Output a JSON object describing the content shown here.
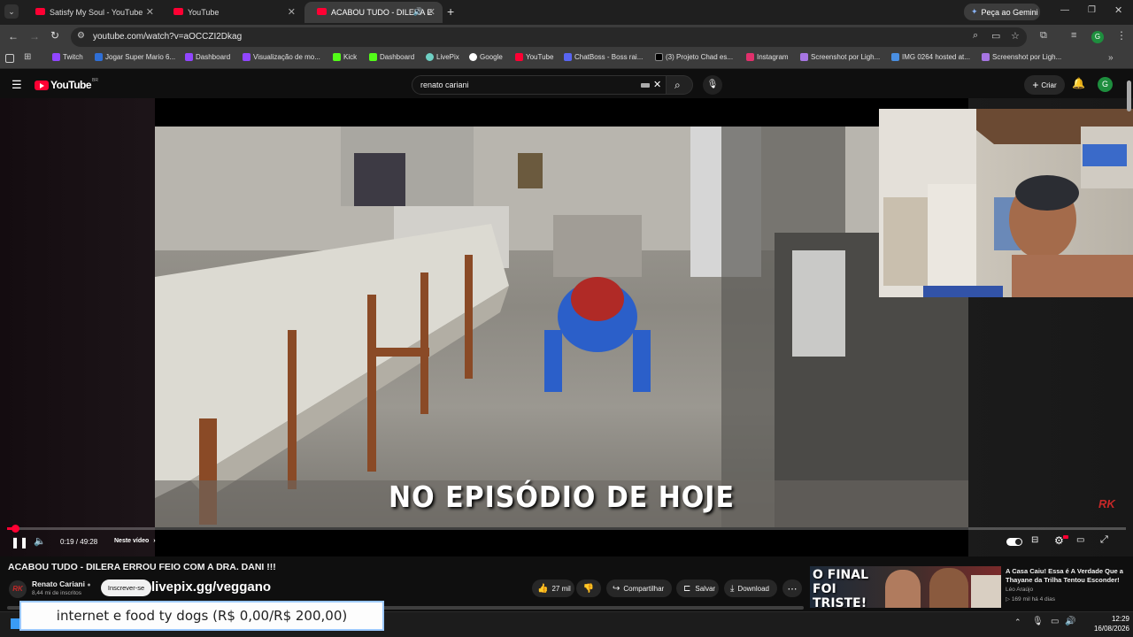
{
  "browser": {
    "tabs": [
      {
        "title": "Satisfy My Soul - YouTube"
      },
      {
        "title": "YouTube"
      },
      {
        "title": "ACABOU TUDO - DILERA E"
      }
    ],
    "gemini_label": "Peça ao Gemini",
    "url": "youtube.com/watch?v=aOCCZI2Dkag",
    "profile_initial": "G",
    "bookmarks": [
      "Twitch",
      "Jogar Super Mario 6...",
      "Dashboard",
      "Visualização de mo...",
      "Kick",
      "Dashboard",
      "LivePix",
      "Google",
      "YouTube",
      "ChatBoss - Boss rai...",
      "(3) Projeto Chad es...",
      "Instagram",
      "Screenshot por Ligh...",
      "IMG 0264 hosted at...",
      "Screenshot por Ligh..."
    ]
  },
  "youtube": {
    "logo_text": "YouTube",
    "logo_region": "BR",
    "search_value": "renato cariani",
    "create_label": "Criar",
    "avatar_initial": "G"
  },
  "player": {
    "subtitle": "NO EPISÓDIO DE HOJE",
    "time": "0:19 / 49:28",
    "chapter_label": "Neste vídeo",
    "progress": 0.0064
  },
  "video_info": {
    "title": "ACABOU TUDO - DILERA ERROU FEIO COM A DRA. DANI !!!",
    "channel_name": "Renato Cariani",
    "subscribers": "8,44 mi de inscritos",
    "subscribe_label": "Inscrever-se",
    "overlay_text": "livepix.gg/veggano",
    "likes": "27 mil",
    "share_label": "Compartilhar",
    "save_label": "Salvar",
    "download_label": "Download"
  },
  "recommended": {
    "thumb_text": "O FINAL FOI TRISTE!",
    "title": "A Casa Caiu! Essa é A Verdade Que a Thayane da Trilha Tentou Esconder!",
    "channel": "Léo Araújo",
    "stats": "169 mil  há 4 dias"
  },
  "donation_text": "internet e food ty dogs (R$ 0,00/R$ 200,00)",
  "taskbar": {
    "time": "12:29",
    "date": "16/08/2026"
  },
  "colors": {
    "youtube_red": "#ff0033",
    "accent": "#3ea6ff"
  }
}
